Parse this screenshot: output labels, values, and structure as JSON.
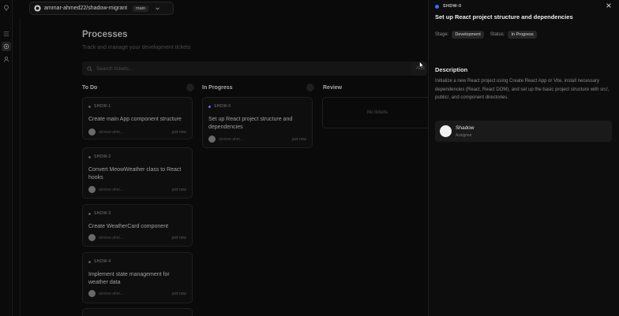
{
  "repo": {
    "name": "ammar-ahmed22/shadow-migrant",
    "branch": "main"
  },
  "header": {
    "title": "Processes",
    "subtitle": "Track and manage your development tickets"
  },
  "search": {
    "placeholder": "Search tickets..."
  },
  "toolbar": {
    "add_label": "Add"
  },
  "columns": [
    {
      "title": "To Do",
      "count": ""
    },
    {
      "title": "In Progress",
      "count": ""
    },
    {
      "title": "Review",
      "empty": "No tickets"
    }
  ],
  "todo": [
    {
      "id": "SHDW-1",
      "title": "Create main App component structure",
      "author": "ammar-ahm...",
      "when": "just now"
    },
    {
      "id": "SHDW-2",
      "title": "Convert MeowWeather class to React hooks",
      "author": "ammar-ahm...",
      "when": "just now"
    },
    {
      "id": "SHDW-3",
      "title": "Create WeatherCard component",
      "author": "ammar-ahm...",
      "when": "just now"
    },
    {
      "id": "SHDW-4",
      "title": "Implement state management for weather data",
      "author": "ammar-ahm...",
      "when": "just now"
    }
  ],
  "in_progress": [
    {
      "id": "SHDW-0",
      "title": "Set up React project structure and dependencies",
      "author": "ammar-ahm...",
      "when": "just now"
    }
  ],
  "panel": {
    "id": "SHDW-0",
    "title": "Set up React project structure and dependencies",
    "stage_label": "Stage:",
    "stage": "Development",
    "status_label": "Status:",
    "status": "In Progress",
    "description_heading": "Description",
    "description": "Initialize a new React project using Create React App or Vite, install necessary dependencies (React, React DOM), and set up the basic project structure with src/, public/, and component directories.",
    "assignee_name": "Shadow",
    "assignee_role": "Assignee"
  },
  "colors": {
    "accent": "#3d6cf0",
    "background": "#0a0a0a",
    "panel": "#0d0d0d"
  }
}
